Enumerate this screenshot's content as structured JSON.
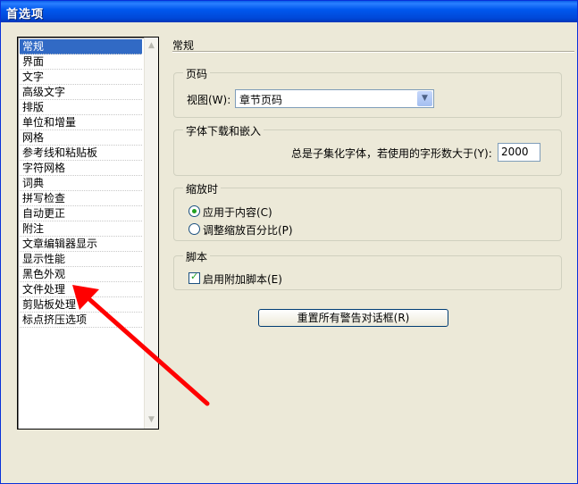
{
  "window": {
    "title": "首选项"
  },
  "categories": [
    "常规",
    "界面",
    "文字",
    "高级文字",
    "排版",
    "单位和增量",
    "网格",
    "参考线和粘贴板",
    "字符网格",
    "词典",
    "拼写检查",
    "自动更正",
    "附注",
    "文章编辑器显示",
    "显示性能",
    "黑色外观",
    "文件处理",
    "剪贴板处理",
    "标点挤压选项"
  ],
  "selected_category": "常规",
  "panel": {
    "title": "常规",
    "page_numbering": {
      "label": "页码",
      "view_label": "视图(W):",
      "view_value": "章节页码"
    },
    "font_download": {
      "label": "字体下载和嵌入",
      "subset_label": "总是子集化字体，若使用的字形数大于(Y):",
      "subset_value": "2000"
    },
    "scaling": {
      "label": "缩放时",
      "option1": "应用于内容(C)",
      "option2": "调整缩放百分比(P)",
      "option1_checked": true
    },
    "scripting": {
      "label": "脚本",
      "enable_label": "启用附加脚本(E)",
      "enabled": true
    },
    "reset_button": "重置所有警告对话框(R)"
  },
  "colors": {
    "selection": "#316ac5",
    "arrow": "#ff0000",
    "title_bar": "#0058ee"
  },
  "icons": {
    "scroll_up": "chevron-up-icon",
    "scroll_down": "chevron-down-icon",
    "annotation": "red-arrow-annotation"
  }
}
